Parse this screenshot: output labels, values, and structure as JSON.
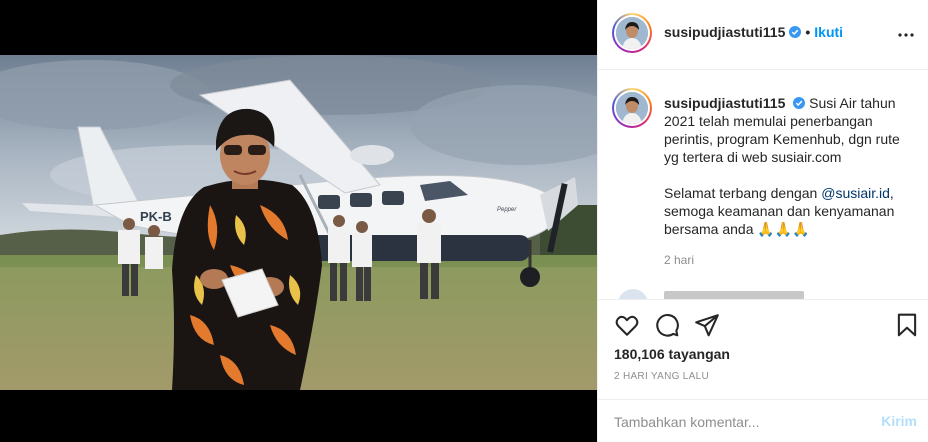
{
  "post": {
    "username": "susipudjiastuti115",
    "follow_separator": "•",
    "follow_label": "Ikuti",
    "more_icon": "more-horizontal-icon",
    "verified_icon": "verified-badge-icon",
    "accent_color": "#0095f6"
  },
  "caption": {
    "username": "susipudjiastuti115",
    "text_part1": "Susi Air tahun 2021 telah memulai penerbangan perintis, program Kemenhub, dgn rute yg tertera di web susiair.com",
    "text_part2_before": "Selamat terbang dengan ",
    "mention": "@susiair.id",
    "text_part2_after": ", semoga keamanan dan kenyamanan bersama anda 🙏🙏🙏",
    "time": "2 hari"
  },
  "actions": {
    "like_icon": "heart-icon",
    "comment_icon": "comment-icon",
    "share_icon": "share-icon",
    "save_icon": "bookmark-icon",
    "views": "180,106 tayangan",
    "date": "2 HARI YANG LALU"
  },
  "comment_form": {
    "placeholder": "Tambahkan komentar...",
    "post_label": "Kirim"
  },
  "video": {
    "mute_icon": "speaker-muted-icon",
    "plane_registration": "PK-B"
  }
}
